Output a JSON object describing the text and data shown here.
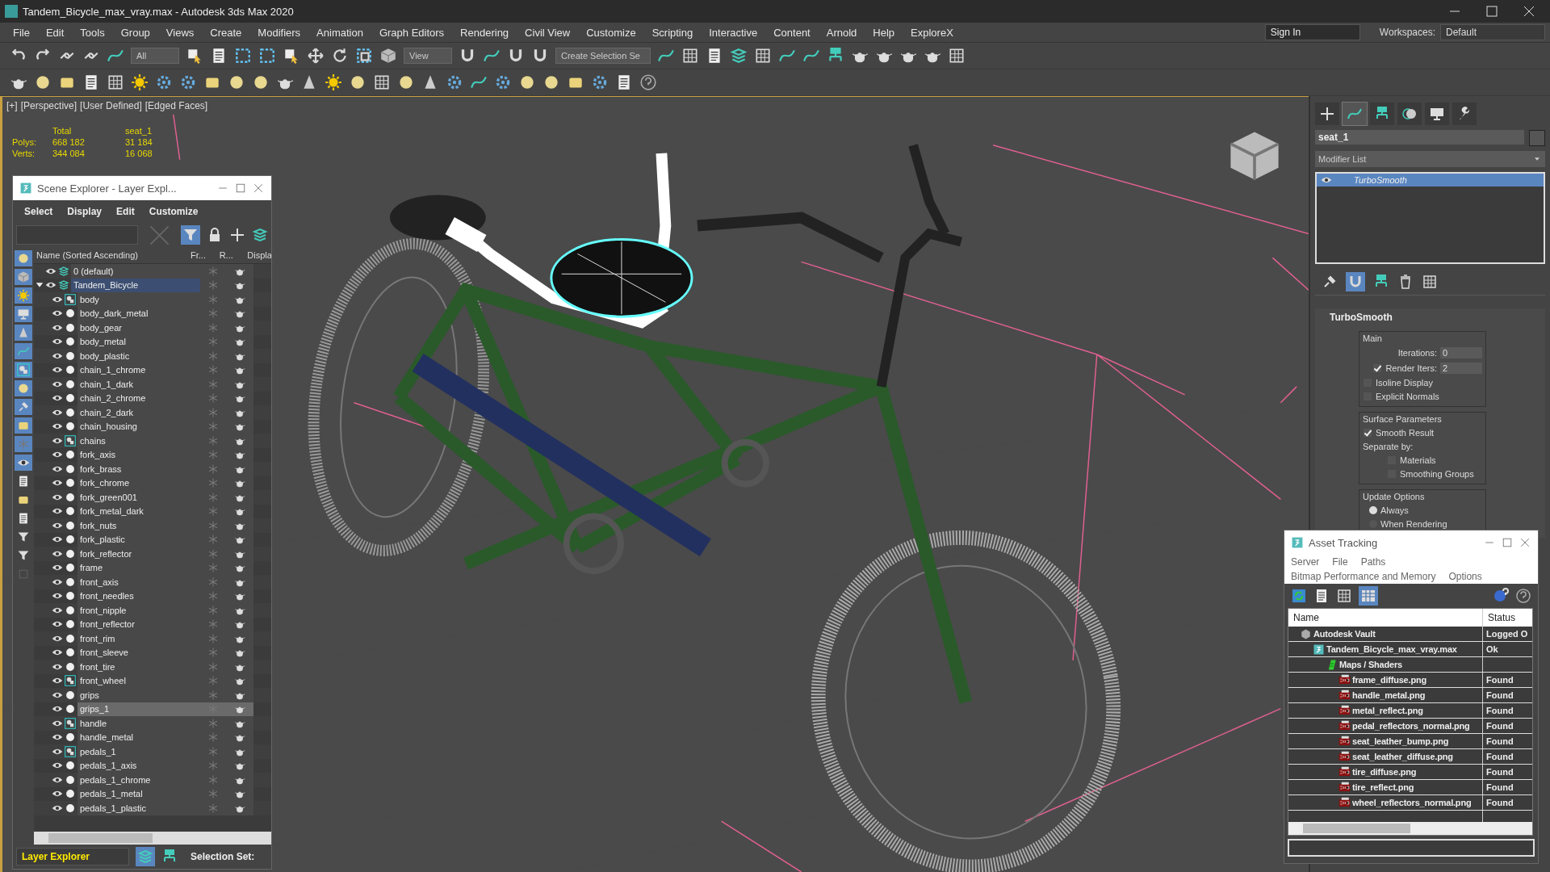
{
  "window": {
    "title": "Tandem_Bicycle_max_vray.max - Autodesk 3ds Max 2020"
  },
  "menu": [
    "File",
    "Edit",
    "Tools",
    "Group",
    "Views",
    "Create",
    "Modifiers",
    "Animation",
    "Graph Editors",
    "Rendering",
    "Civil View",
    "Customize",
    "Scripting",
    "Interactive",
    "Content",
    "Arnold",
    "Help",
    "ExploreX"
  ],
  "toolbar": {
    "selection_filter": "All",
    "reference_coordinates": "View",
    "selection_set": "Create Selection Se"
  },
  "account": {
    "sign_in": "Sign In"
  },
  "workspaces": {
    "label": "Workspaces:",
    "value": "Default"
  },
  "viewport": {
    "labels": [
      "[+]",
      "[Perspective]",
      "[User Defined]",
      "[Edged Faces]"
    ],
    "stats": {
      "headers": [
        "Total",
        "seat_1"
      ],
      "rows": [
        {
          "label": "Polys:",
          "total": "668 182",
          "selection": "31 184"
        },
        {
          "label": "Verts:",
          "total": "344 084",
          "selection": "16 068"
        }
      ]
    }
  },
  "scene_explorer": {
    "title": "Scene Explorer - Layer Expl...",
    "menu": [
      "Select",
      "Display",
      "Edit",
      "Customize"
    ],
    "columns": [
      "Name (Sorted Ascending)",
      "Fr...",
      "R...",
      "Displa"
    ],
    "layers": [
      {
        "name": "0 (default)",
        "selected": false,
        "expanded": false
      },
      {
        "name": "Tandem_Bicycle",
        "selected": true,
        "expanded": true,
        "children": [
          {
            "name": "body",
            "kind": "group",
            "selected": false
          },
          {
            "name": "body_dark_metal",
            "kind": "object",
            "selected": false
          },
          {
            "name": "body_gear",
            "kind": "object",
            "selected": false
          },
          {
            "name": "body_metal",
            "kind": "object",
            "selected": false
          },
          {
            "name": "body_plastic",
            "kind": "object",
            "selected": false
          },
          {
            "name": "chain_1_chrome",
            "kind": "object",
            "selected": false
          },
          {
            "name": "chain_1_dark",
            "kind": "object",
            "selected": false
          },
          {
            "name": "chain_2_chrome",
            "kind": "object",
            "selected": false
          },
          {
            "name": "chain_2_dark",
            "kind": "object",
            "selected": false
          },
          {
            "name": "chain_housing",
            "kind": "object",
            "selected": false
          },
          {
            "name": "chains",
            "kind": "group",
            "selected": false
          },
          {
            "name": "fork_axis",
            "kind": "object",
            "selected": false
          },
          {
            "name": "fork_brass",
            "kind": "object",
            "selected": false
          },
          {
            "name": "fork_chrome",
            "kind": "object",
            "selected": false
          },
          {
            "name": "fork_green001",
            "kind": "object",
            "selected": false
          },
          {
            "name": "fork_metal_dark",
            "kind": "object",
            "selected": false
          },
          {
            "name": "fork_nuts",
            "kind": "object",
            "selected": false
          },
          {
            "name": "fork_plastic",
            "kind": "object",
            "selected": false
          },
          {
            "name": "fork_reflector",
            "kind": "object",
            "selected": false
          },
          {
            "name": "frame",
            "kind": "object",
            "selected": false
          },
          {
            "name": "front_axis",
            "kind": "object",
            "selected": false
          },
          {
            "name": "front_needles",
            "kind": "object",
            "selected": false
          },
          {
            "name": "front_nipple",
            "kind": "object",
            "selected": false
          },
          {
            "name": "front_reflector",
            "kind": "object",
            "selected": false
          },
          {
            "name": "front_rim",
            "kind": "object",
            "selected": false
          },
          {
            "name": "front_sleeve",
            "kind": "object",
            "selected": false
          },
          {
            "name": "front_tire",
            "kind": "object",
            "selected": false
          },
          {
            "name": "front_wheel",
            "kind": "group",
            "selected": false
          },
          {
            "name": "grips",
            "kind": "object",
            "selected": false
          },
          {
            "name": "grips_1",
            "kind": "object",
            "selected": true
          },
          {
            "name": "handle",
            "kind": "group",
            "selected": false
          },
          {
            "name": "handle_metal",
            "kind": "object",
            "selected": false
          },
          {
            "name": "pedals_1",
            "kind": "group",
            "selected": false
          },
          {
            "name": "pedals_1_axis",
            "kind": "object",
            "selected": false
          },
          {
            "name": "pedals_1_chrome",
            "kind": "object",
            "selected": false
          },
          {
            "name": "pedals_1_metal",
            "kind": "object",
            "selected": false
          },
          {
            "name": "pedals_1_plastic",
            "kind": "object",
            "selected": false
          }
        ]
      }
    ],
    "footer": {
      "explorer": "Layer Explorer",
      "selection_set": "Selection Set:"
    }
  },
  "command_panel": {
    "tabs": [
      {
        "kind": "create",
        "selected": false
      },
      {
        "kind": "modify",
        "selected": true
      },
      {
        "kind": "hierarchy",
        "selected": false
      },
      {
        "kind": "motion",
        "selected": false
      },
      {
        "kind": "display",
        "selected": false
      },
      {
        "kind": "utilities",
        "selected": false
      }
    ],
    "object_name": "seat_1",
    "modifier_list": "Modifier List",
    "modifiers": [
      {
        "name": "TurboSmooth",
        "selected": true
      }
    ],
    "rollout": {
      "title": "TurboSmooth",
      "main": {
        "label": "Main",
        "iterations": {
          "label": "Iterations:",
          "value": "0"
        },
        "render_iters": {
          "label": "Render Iters:",
          "value": "2",
          "checked": true
        },
        "isoline_display": {
          "label": "Isoline Display",
          "checked": false
        },
        "explicit_normals": {
          "label": "Explicit Normals",
          "checked": false
        }
      },
      "surface": {
        "label": "Surface Parameters",
        "smooth_result": {
          "label": "Smooth Result",
          "checked": true
        },
        "separate_by": "Separate by:",
        "materials": {
          "label": "Materials",
          "checked": false
        },
        "smoothing_groups": {
          "label": "Smoothing Groups",
          "checked": false
        }
      },
      "update": {
        "label": "Update Options",
        "options": [
          {
            "label": "Always",
            "selected": true
          },
          {
            "label": "When Rendering",
            "selected": false
          }
        ]
      }
    }
  },
  "asset_tracking": {
    "title": "Asset Tracking",
    "menu": [
      "Server",
      "File",
      "Paths"
    ],
    "menu_2": [
      "Bitmap Performance and Memory",
      "Options"
    ],
    "columns": [
      "Name",
      "Status"
    ],
    "assets": [
      {
        "name": "Autodesk Vault",
        "kind": "vault",
        "status": "Logged O",
        "children": [
          {
            "name": "Tandem_Bicycle_max_vray.max",
            "kind": "scene",
            "status": "Ok",
            "children": [
              {
                "name": "Maps / Shaders",
                "kind": "maps",
                "children": [
                  {
                    "name": "frame_diffuse.png",
                    "kind": "png",
                    "status": "Found"
                  },
                  {
                    "name": "handle_metal.png",
                    "kind": "png",
                    "status": "Found"
                  },
                  {
                    "name": "metal_reflect.png",
                    "kind": "png",
                    "status": "Found"
                  },
                  {
                    "name": "pedal_reflectors_normal.png",
                    "kind": "png",
                    "status": "Found"
                  },
                  {
                    "name": "seat_leather_bump.png",
                    "kind": "png",
                    "status": "Found"
                  },
                  {
                    "name": "seat_leather_diffuse.png",
                    "kind": "png",
                    "status": "Found"
                  },
                  {
                    "name": "tire_diffuse.png",
                    "kind": "png",
                    "status": "Found"
                  },
                  {
                    "name": "tire_reflect.png",
                    "kind": "png",
                    "status": "Found"
                  },
                  {
                    "name": "wheel_reflectors_normal.png",
                    "kind": "png",
                    "status": "Found"
                  }
                ]
              }
            ]
          }
        ]
      }
    ]
  }
}
